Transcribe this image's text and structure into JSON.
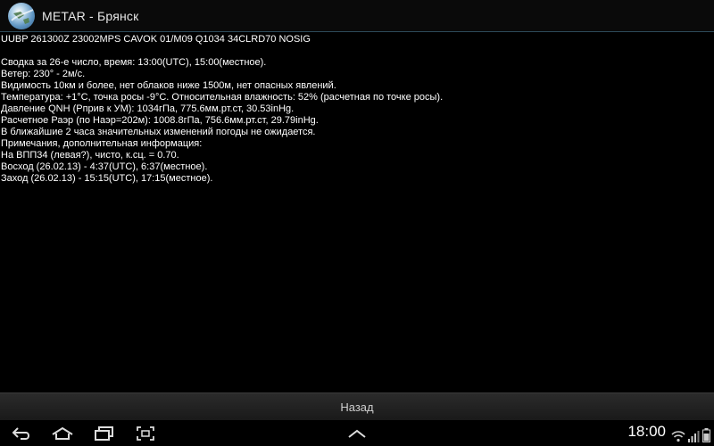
{
  "app": {
    "title": "METAR - Брянск"
  },
  "report": {
    "raw": "UUBP 261300Z 23002MPS CAVOK 01/M09 Q1034 34CLRD70 NOSIG",
    "lines": [
      "Сводка  за 26-е число, время: 13:00(UTC), 15:00(местное).",
      "Ветер: 230° - 2м/с.",
      "Видимость 10км и более, нет облаков ниже 1500м, нет опасных явлений.",
      "Температура: +1°C, точка росы -9°C. Относительная влажность: 52% (расчетная по точке росы).",
      "Давление QNH (Рприв к УМ): 1034гПа, 775.6мм.рт.ст, 30.53inHg.",
      "Расчетное Раэр (по Наэр=202м): 1008.8гПа, 756.6мм.рт.ст, 29.79inHg.",
      "В ближайшие 2 часа значительных изменений погоды не ожидается.",
      "Примечания, дополнительная информация:",
      "На ВПП34 (левая?), чисто, к.сц. = 0.70.",
      "Восход (26.02.13) - 4:37(UTC), 6:37(местное).",
      "Заход (26.02.13) - 15:15(UTC), 17:15(местное)."
    ]
  },
  "actions": {
    "back_label": "Назад"
  },
  "system": {
    "time": "18:00",
    "icons": [
      "back-icon",
      "home-icon",
      "recent-apps-icon",
      "screenshot-icon",
      "menu-up-icon",
      "wifi-icon",
      "signal-icon",
      "battery-icon"
    ]
  },
  "colors": {
    "background": "#000000",
    "text": "#ffffff",
    "title_divider": "#2d4a5a",
    "button_bg": "#222222"
  }
}
